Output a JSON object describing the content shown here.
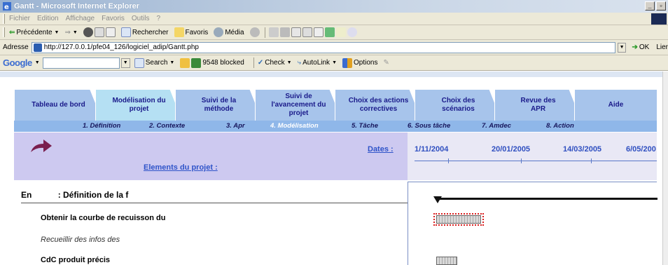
{
  "window": {
    "title": "Gantt - Microsoft Internet Explorer"
  },
  "menu": [
    "Fichier",
    "Edition",
    "Affichage",
    "Favoris",
    "Outils",
    "?"
  ],
  "toolbar": {
    "back": "Précédente",
    "search": "Rechercher",
    "favorites": "Favoris",
    "media": "Média"
  },
  "address": {
    "label": "Adresse",
    "url": "http://127.0.0.1/pfe04_126/logiciel_adip/Gantt.php",
    "go": "OK",
    "links": "Lier"
  },
  "google": {
    "logo": "Google",
    "search": "Search",
    "blocked": "9548 blocked",
    "check": "Check",
    "autolink": "AutoLink",
    "options": "Options"
  },
  "tabs": [
    {
      "label": "Tableau de bord"
    },
    {
      "label": "Modélisation du projet"
    },
    {
      "label": "Suivi de la méthode"
    },
    {
      "label": "Suivi de l'avancement du projet"
    },
    {
      "label": "Choix des actions correctives"
    },
    {
      "label": "Choix des scénarios"
    },
    {
      "label": "Revue des APR"
    },
    {
      "label": "Aide"
    }
  ],
  "subnav": [
    {
      "label": "1. Définition"
    },
    {
      "label": "2. Contexte"
    },
    {
      "label": "3. Apr"
    },
    {
      "label": "4. Modélisation"
    },
    {
      "label": "5. Tâche"
    },
    {
      "label": "6. Sous tâche"
    },
    {
      "label": "7. Amdec"
    },
    {
      "label": "8. Action"
    }
  ],
  "project": {
    "dates_label": "Dates :",
    "elements_label": "Elements du projet :",
    "timeline_dates": [
      "1/11/2004",
      "20/01/2005",
      "14/03/2005",
      "6/05/200"
    ]
  },
  "tasks": {
    "header_prefix": "En",
    "header_rest": ": Définition de la f",
    "rows": [
      {
        "label": "Obtenir la courbe de recuisson du ",
        "style": "bold"
      },
      {
        "label": "Recueillir des infos des ",
        "style": "italic"
      },
      {
        "label": "CdC produit précis",
        "style": "bold"
      }
    ]
  },
  "colors": {
    "tab": "#a7c4eb",
    "tab_active": "#b5e0f3",
    "subnav": "#8fb7e9",
    "panel": "#cdc9f0",
    "link": "#2f54c9",
    "selection": "#d81e1e"
  }
}
